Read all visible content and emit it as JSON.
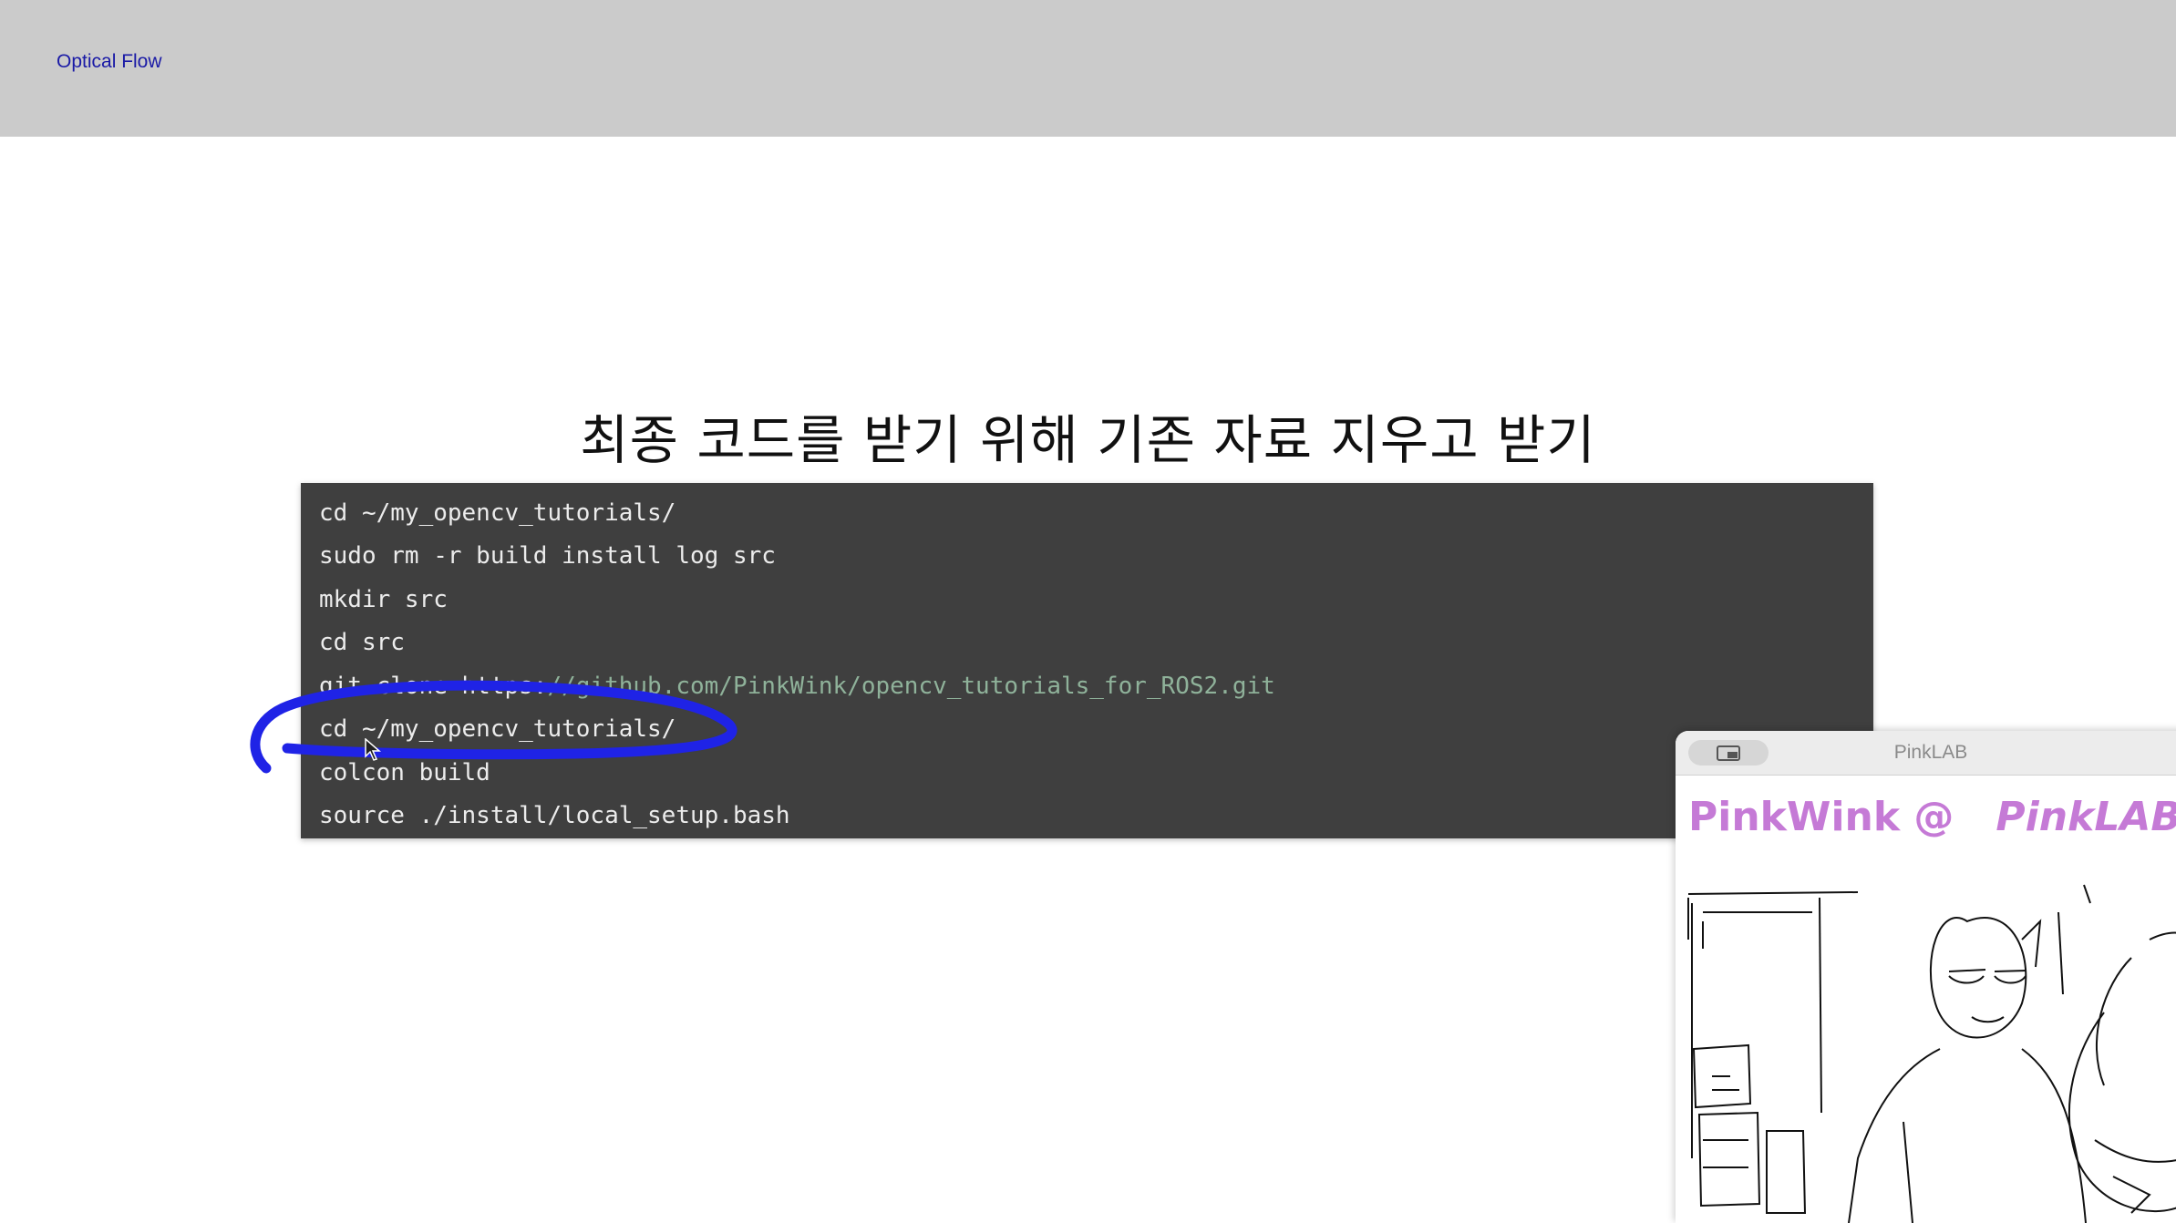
{
  "header": {
    "title": "Optical Flow"
  },
  "slide": {
    "title": "최종 코드를 받기 위해 기존 자료 지우고 받기"
  },
  "code": {
    "lines": [
      "cd ~/my_opencv_tutorials/",
      "sudo rm -r build install log src",
      "mkdir src",
      "cd src",
      "git clone https:",
      "cd ~/my_opencv_tutorials/",
      "colcon build",
      "source ./install/local_setup.bash"
    ],
    "url_path": "//github.com/PinkWink/opencv_tutorials_for_ROS2.git"
  },
  "pip": {
    "title": "PinkLAB",
    "overlay_left": "PinkWink @",
    "overlay_right": "PinkLAB",
    "icons": {
      "pip-toggle": "picture-in-picture-icon"
    }
  },
  "colors": {
    "annotation": "#1f23e6",
    "code_bg": "#3f3f3f",
    "url": "#8fb29a",
    "overlay": "#c57ad6"
  }
}
